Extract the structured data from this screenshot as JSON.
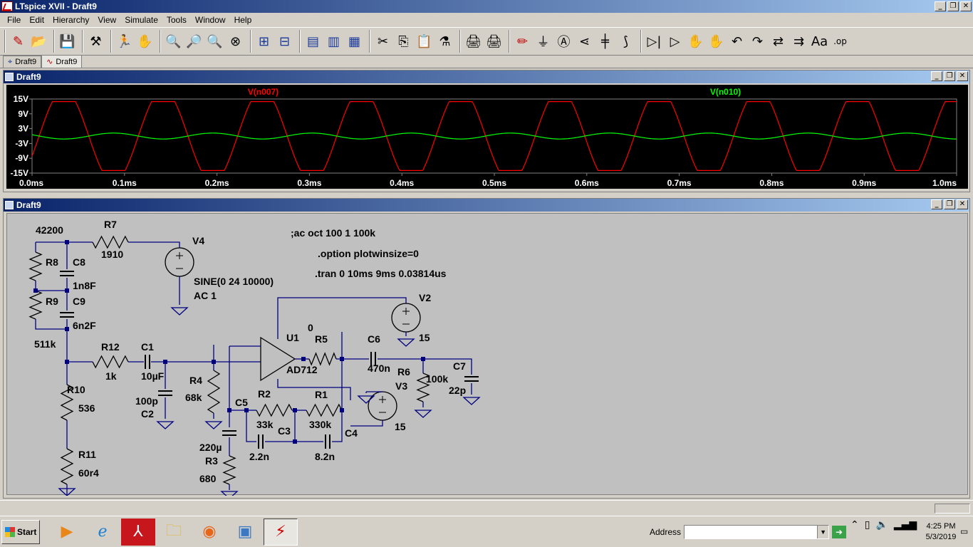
{
  "app": {
    "title": "LTspice XVII - Draft9"
  },
  "menu": [
    "File",
    "Edit",
    "Hierarchy",
    "View",
    "Simulate",
    "Tools",
    "Window",
    "Help"
  ],
  "toolbar": [
    [
      "✎",
      "📂"
    ],
    [
      "💾"
    ],
    [
      "⚒"
    ],
    [
      "🏃",
      "✋"
    ],
    [
      "🔍",
      "🔎",
      "🔍",
      "⊗"
    ],
    [
      "⊞",
      "⊟"
    ],
    [
      "▤",
      "▥",
      "▦"
    ],
    [
      "✂",
      "⎘",
      "📋",
      "⚗"
    ],
    [
      "🖨",
      "🖨"
    ],
    [
      "✏",
      "⏚",
      "Ⓐ",
      "⋖",
      "╪",
      "⟆"
    ],
    [
      "▷|",
      "▷",
      "✋",
      "✋",
      "↶",
      "↷",
      "⇄",
      "⇉",
      "Aa",
      ".op"
    ]
  ],
  "tabs": [
    {
      "label": "Draft9",
      "icon": "schematic-icon"
    },
    {
      "label": "Draft9",
      "icon": "waveform-icon"
    }
  ],
  "plot_window": {
    "title": "Draft9"
  },
  "schematic_window": {
    "title": "Draft9"
  },
  "chart_data": {
    "type": "line",
    "ylim": [
      -15,
      15
    ],
    "xlim": [
      0,
      1.0
    ],
    "yticks": [
      "15V",
      "9V",
      "3V",
      "-3V",
      "-9V",
      "-15V"
    ],
    "xticks": [
      "0.0ms",
      "0.1ms",
      "0.2ms",
      "0.3ms",
      "0.4ms",
      "0.5ms",
      "0.6ms",
      "0.7ms",
      "0.8ms",
      "0.9ms",
      "1.0ms"
    ],
    "grid": false,
    "series": [
      {
        "name": "V(n007)",
        "color": "#ff0000",
        "amplitude": 15,
        "offset": 0,
        "frequency_khz": 9.32,
        "clip": 15
      },
      {
        "name": "V(n010)",
        "color": "#00ff00",
        "amplitude": 1.2,
        "offset": 0,
        "frequency_khz": 9.32,
        "clip": null
      }
    ]
  },
  "schematic": {
    "labels": [
      {
        "t": "42200",
        "name": "r8-value"
      },
      {
        "t": "R7",
        "name": "r7-ref"
      },
      {
        "t": "1910",
        "name": "r7-value"
      },
      {
        "t": "V4",
        "name": "v4-ref"
      },
      {
        "t": "R8",
        "name": "r8-ref"
      },
      {
        "t": "C8",
        "name": "c8-ref"
      },
      {
        "t": "1n8F",
        "name": "c8-value"
      },
      {
        "t": "R9",
        "name": "r9-ref"
      },
      {
        "t": "C9",
        "name": "c9-ref"
      },
      {
        "t": "6n2F",
        "name": "c9-value"
      },
      {
        "t": "511k",
        "name": "r9-value"
      },
      {
        "t": "SINE(0 24 10000)",
        "name": "v4-value"
      },
      {
        "t": "AC 1",
        "name": "v4-ac"
      },
      {
        "t": ";ac oct 100 1 100k",
        "name": "directive-ac"
      },
      {
        "t": ".option plotwinsize=0",
        "name": "directive-option"
      },
      {
        "t": ".tran 0 10ms 9ms 0.03814us",
        "name": "directive-tran"
      },
      {
        "t": "V2",
        "name": "v2-ref"
      },
      {
        "t": "15",
        "name": "v2-value"
      },
      {
        "t": "U1",
        "name": "u1-ref"
      },
      {
        "t": "0",
        "name": "r5-value"
      },
      {
        "t": "R5",
        "name": "r5-ref"
      },
      {
        "t": "C6",
        "name": "c6-ref"
      },
      {
        "t": "470n",
        "name": "c6-value"
      },
      {
        "t": "AD712",
        "name": "u1-value"
      },
      {
        "t": "R6",
        "name": "r6-ref"
      },
      {
        "t": "V3",
        "name": "v3-ref"
      },
      {
        "t": "100k",
        "name": "r6-value"
      },
      {
        "t": "C7",
        "name": "c7-ref"
      },
      {
        "t": "22p",
        "name": "c7-value"
      },
      {
        "t": "R12",
        "name": "r12-ref"
      },
      {
        "t": "C1",
        "name": "c1-ref"
      },
      {
        "t": "1k",
        "name": "r12-value"
      },
      {
        "t": "10µF",
        "name": "c1-value"
      },
      {
        "t": "R4",
        "name": "r4-ref"
      },
      {
        "t": "68k",
        "name": "r4-value"
      },
      {
        "t": "100p",
        "name": "c2-value"
      },
      {
        "t": "C2",
        "name": "c2-ref"
      },
      {
        "t": "R10",
        "name": "r10-ref"
      },
      {
        "t": "536",
        "name": "r10-value"
      },
      {
        "t": "C5",
        "name": "c5-ref"
      },
      {
        "t": "R2",
        "name": "r2-ref"
      },
      {
        "t": "R1",
        "name": "r1-ref"
      },
      {
        "t": "33k",
        "name": "r2-value"
      },
      {
        "t": "C3",
        "name": "c3-ref"
      },
      {
        "t": "330k",
        "name": "r1-value"
      },
      {
        "t": "C4",
        "name": "c4-ref"
      },
      {
        "t": "15",
        "name": "v3-value"
      },
      {
        "t": "220µ",
        "name": "c5-value"
      },
      {
        "t": "R3",
        "name": "r3-ref"
      },
      {
        "t": "680",
        "name": "r3-value"
      },
      {
        "t": "2.2n",
        "name": "c3-value"
      },
      {
        "t": "8.2n",
        "name": "c4-value"
      },
      {
        "t": "R11",
        "name": "r11-ref"
      },
      {
        "t": "60r4",
        "name": "r11-value"
      }
    ]
  },
  "taskbar": {
    "start_label": "Start",
    "address_label": "Address",
    "address_value": "",
    "time": "4:25 PM",
    "date": "5/3/2019"
  }
}
